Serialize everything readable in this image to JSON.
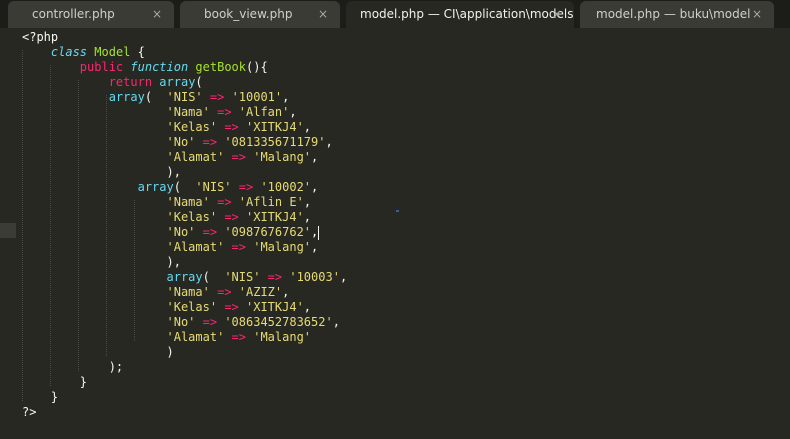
{
  "tabs": [
    {
      "label": "controller.php",
      "close": "×",
      "active": false
    },
    {
      "label": "book_view.php",
      "close": "×",
      "active": false
    },
    {
      "label": "model.php — CI\\application\\models",
      "close": "×",
      "active": true
    },
    {
      "label": "model.php — buku\\model",
      "close": "×",
      "active": false
    }
  ],
  "code": {
    "open_tag": "<?php",
    "class_kw": "class",
    "class_name": "Model",
    "brace_open": " {",
    "public_kw": "public",
    "function_kw": "function",
    "fn_name": "getBook",
    "fn_tail": "(){",
    "return_kw": "return",
    "array_kw": "array",
    "paren_open": "(",
    "arrow": "=>",
    "records": [
      {
        "nis_key": "'NIS'",
        "nis_val": "'10001'",
        "nama_key": "'Nama'",
        "nama_val": "'Alfan'",
        "kelas_key": "'Kelas'",
        "kelas_val": "'XITKJ4'",
        "no_key": "'No'",
        "no_val": "'081335671179'",
        "alamat_key": "'Alamat'",
        "alamat_val": "'Malang'",
        "close": "),"
      },
      {
        "nis_key": "'NIS'",
        "nis_val": "'10002'",
        "nama_key": "'Nama'",
        "nama_val": "'Aflin E'",
        "kelas_key": "'Kelas'",
        "kelas_val": "'XITKJ4'",
        "no_key": "'No'",
        "no_val": "'0987676762'",
        "alamat_key": "'Alamat'",
        "alamat_val": "'Malang'",
        "close": "),"
      },
      {
        "nis_key": "'NIS'",
        "nis_val": "'10003'",
        "nama_key": "'Nama'",
        "nama_val": "'AZIZ'",
        "kelas_key": "'Kelas'",
        "kelas_val": "'XITKJ4'",
        "no_key": "'No'",
        "no_val": "'0863452783652'",
        "alamat_key": "'Alamat'",
        "alamat_val": "'Malang'",
        "close": ")"
      }
    ],
    "return_close": ");",
    "fn_close": "}",
    "class_close": "}",
    "close_tag": "?>"
  },
  "colors": {
    "background": "#272822",
    "keyword": "#f92672",
    "storage": "#66d9ef",
    "entity": "#a6e22e",
    "string": "#e6db74",
    "text": "#f8f8f2"
  }
}
